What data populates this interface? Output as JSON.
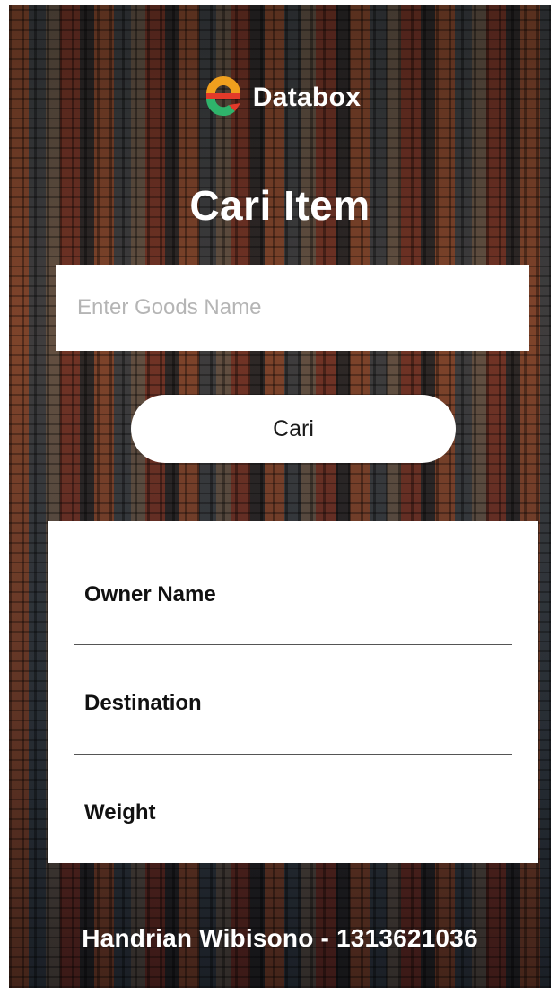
{
  "app": {
    "brand_name": "Databox",
    "logo_icon": "databox-logo-icon",
    "colors": {
      "logo_orange": "#f0a01e",
      "logo_red": "#e23a2a",
      "logo_green": "#2fb36b",
      "card_bg": "#ffffff",
      "text_light": "#ffffff"
    }
  },
  "page": {
    "title": "Cari Item"
  },
  "search": {
    "placeholder": "Enter Goods Name",
    "value": "",
    "button_label": "Cari"
  },
  "result": {
    "fields": [
      {
        "label": "Owner Name"
      },
      {
        "label": "Destination"
      },
      {
        "label": "Weight"
      }
    ]
  },
  "footer": {
    "credit": "Handrian Wibisono - 1313621036"
  }
}
